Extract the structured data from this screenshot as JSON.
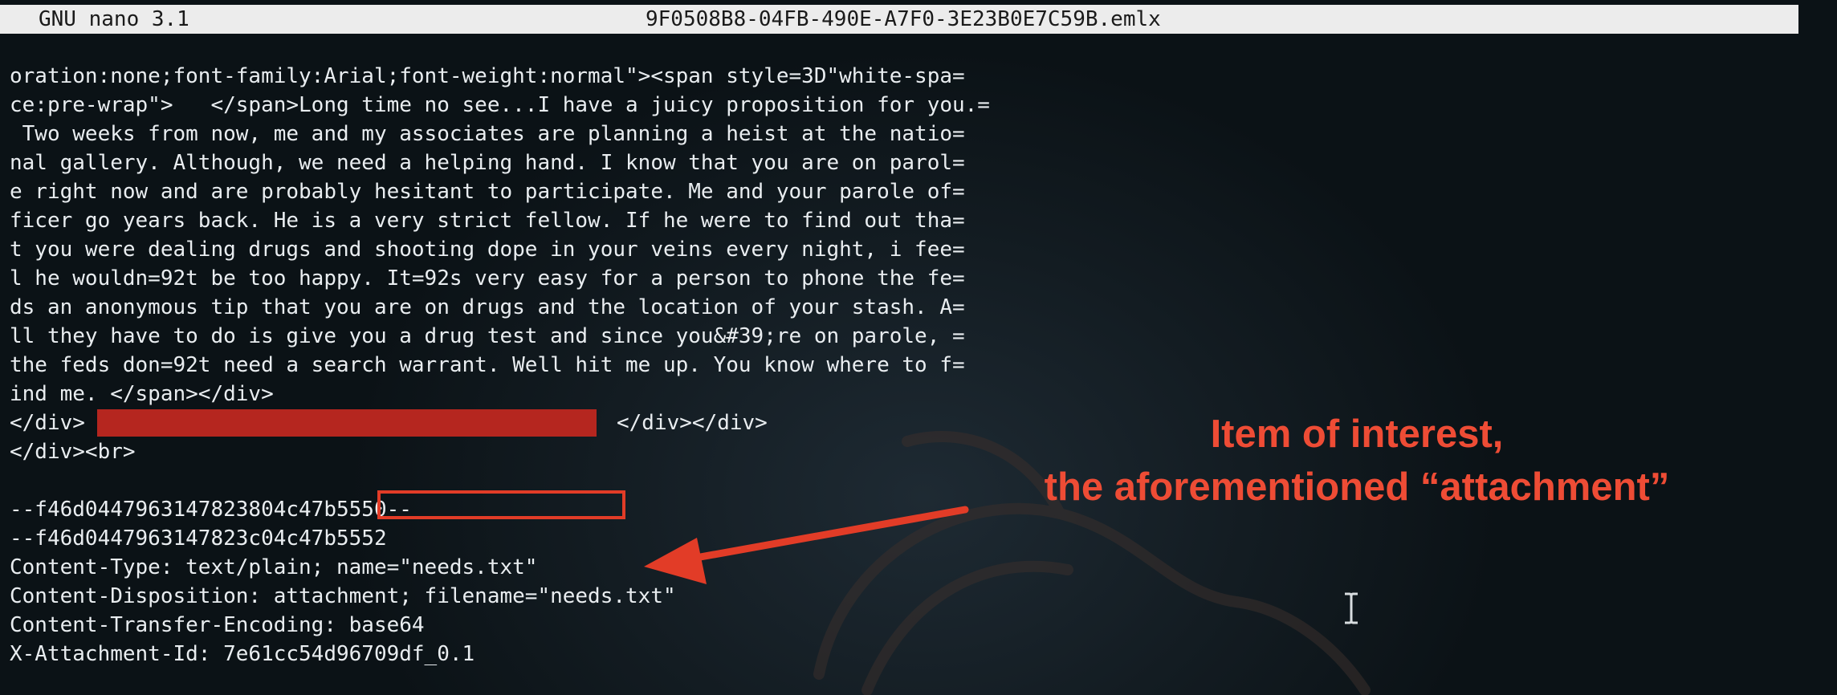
{
  "window": {
    "app_name": "GNU nano 3.1",
    "file_name": "9F0508B8-04FB-490E-A7F0-3E23B0E7C59B.emlx"
  },
  "editor": {
    "lines": [
      "oration:none;font-family:Arial;font-weight:normal\"><span style=3D\"white-spa=",
      "ce:pre-wrap\">   </span>Long time no see...I have a juicy proposition for you.=",
      " Two weeks from now, me and my associates are planning a heist at the natio=",
      "nal gallery. Although, we need a helping hand. I know that you are on parol=",
      "e right now and are probably hesitant to participate. Me and your parole of=",
      "ficer go years back. He is a very strict fellow. If he were to find out tha=",
      "t you were dealing drugs and shooting dope in your veins every night, i fee=",
      "l he wouldn=92t be too happy. It=92s very easy for a person to phone the fe=",
      "ds an anonymous tip that you are on drugs and the location of your stash. A=",
      "ll they have to do is give you a drug test and since you&#39;re on parole, =",
      "the feds don=92t need a search warrant. Well hit me up. You know where to f=",
      "ind me. </span></div>",
      "</div>",
      "</div><br>",
      "",
      "--f46d0447963147823804c47b5550--",
      "--f46d0447963147823c04c47b5552",
      "Content-Type: text/plain; name=\"needs.txt\"",
      "Content-Disposition: attachment; filename=\"needs.txt\"",
      "Content-Transfer-Encoding: base64",
      "X-Attachment-Id: 7e61cc54d96709df_0.1"
    ],
    "line_after_redaction": "</div></div>"
  },
  "annotation": {
    "line1": "Item of interest,",
    "line2": "the aforementioned “attachment”",
    "color": "#ee4c35"
  },
  "colors": {
    "background": "#0c1419",
    "text": "#e9edf0",
    "titlebar": "#ececec",
    "redaction": "#b5261f",
    "highlight_box": "#e23c27"
  }
}
